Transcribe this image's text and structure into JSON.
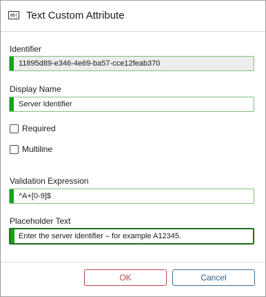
{
  "dialog": {
    "title": "Text Custom Attribute",
    "title_icon": "text-field-icon",
    "title_icon_glyph": "ab|"
  },
  "fields": {
    "identifier": {
      "label": "Identifier",
      "value": "11895d89-e346-4e69-ba57-cce12feab370"
    },
    "display_name": {
      "label": "Display Name",
      "value": "Server Identifier"
    },
    "required": {
      "label": "Required",
      "checked": false
    },
    "multiline": {
      "label": "Multiline",
      "checked": false
    },
    "validation": {
      "label": "Validation Expression",
      "value": "^A+[0-9]$"
    },
    "placeholder": {
      "label": "Placeholder Text",
      "value": "Enter the server identifier – for example A12345."
    }
  },
  "buttons": {
    "ok": "OK",
    "cancel": "Cancel"
  },
  "colors": {
    "accent_green": "#17a317",
    "ok_red": "#b54646",
    "cancel_blue": "#2e5f86"
  }
}
